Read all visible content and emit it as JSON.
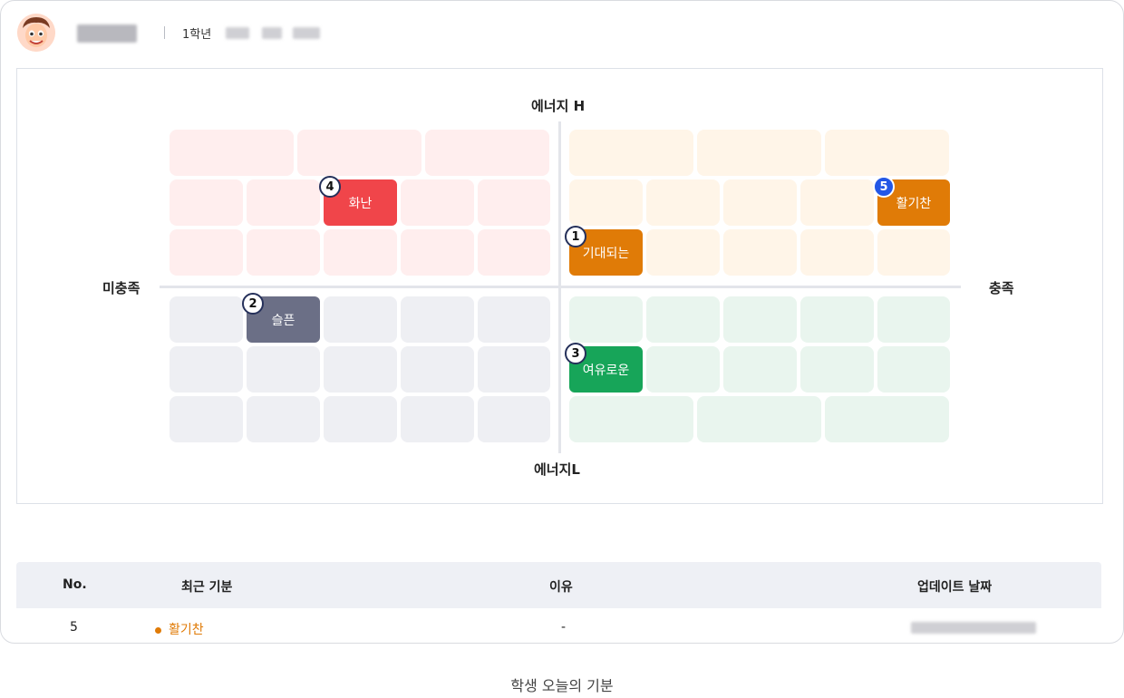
{
  "header": {
    "grade": "1학년"
  },
  "chart": {
    "axis_top": "에너지 H",
    "axis_bottom": "에너지L",
    "axis_left": "미충족",
    "axis_right": "충족",
    "moods": [
      {
        "no": "1",
        "label": "기대되는",
        "color": "#e07b07"
      },
      {
        "no": "2",
        "label": "슬픈",
        "color": "#6b6f86"
      },
      {
        "no": "3",
        "label": "여유로운",
        "color": "#17a559"
      },
      {
        "no": "4",
        "label": "화난",
        "color": "#f0454a"
      },
      {
        "no": "5",
        "label": "활기찬",
        "color": "#e07b07"
      }
    ]
  },
  "table": {
    "headers": [
      "No.",
      "최근 기분",
      "이유",
      "업데이트 날짜"
    ],
    "rows": [
      {
        "no": "5",
        "mood": "활기찬",
        "mood_color": "#e07b07",
        "reason": "-"
      }
    ]
  },
  "caption": "학생 오늘의 기분"
}
